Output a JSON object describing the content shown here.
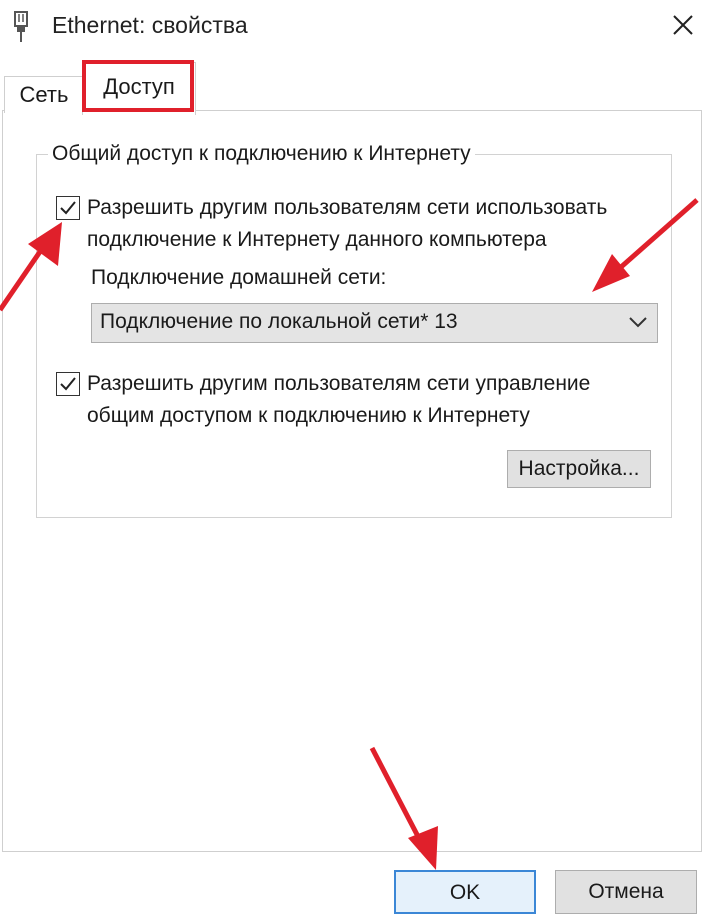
{
  "window": {
    "title": "Ethernet: свойства",
    "icon": "network-adapter-icon",
    "close_icon": "close-icon"
  },
  "tabs": [
    {
      "label": "Сеть",
      "active": false
    },
    {
      "label": "Доступ",
      "active": true
    }
  ],
  "sharing": {
    "group_title": "Общий доступ к подключению к Интернету",
    "allow_connect": {
      "label": "Разрешить другим пользователям сети использовать подключение к Интернету данного компьютера",
      "checked": true
    },
    "home_network_label": "Подключение домашней сети:",
    "home_network_select": {
      "value": "Подключение по локальной сети* 13",
      "icon": "chevron-down-icon"
    },
    "allow_control": {
      "label": "Разрешить другим пользователям сети управление общим доступом к подключению к Интернету",
      "checked": true
    },
    "settings_button": "Настройка..."
  },
  "footer": {
    "ok_button": "OK",
    "cancel_button": "Отмена"
  },
  "annotations": {
    "highlight_color": "#e0202b",
    "arrow_color": "#e0202b"
  }
}
